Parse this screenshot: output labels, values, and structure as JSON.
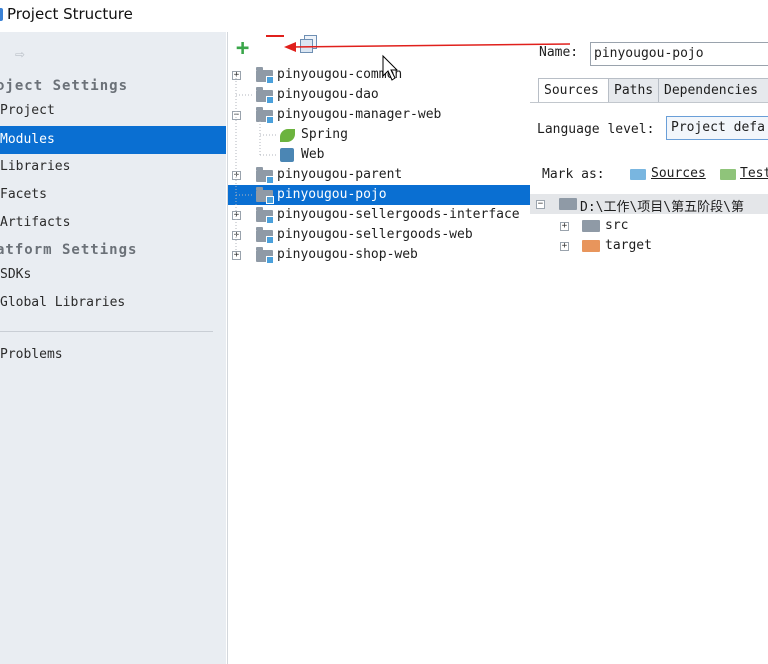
{
  "window": {
    "title": "Project Structure"
  },
  "sidebar": {
    "project_settings_header": "oject Settings",
    "platform_settings_header": "atform Settings",
    "items": [
      {
        "label": "Project"
      },
      {
        "label": "Modules"
      },
      {
        "label": "Libraries"
      },
      {
        "label": "Facets"
      },
      {
        "label": "Artifacts"
      },
      {
        "label": "SDKs"
      },
      {
        "label": "Global Libraries"
      },
      {
        "label": "Problems"
      }
    ],
    "selected": "Modules"
  },
  "toolbar": {
    "add": "+"
  },
  "tree": {
    "rows": [
      {
        "label": "pinyougou-common"
      },
      {
        "label": "pinyougou-dao"
      },
      {
        "label": "pinyougou-manager-web"
      },
      {
        "label": "Spring"
      },
      {
        "label": "Web"
      },
      {
        "label": "pinyougou-parent"
      },
      {
        "label": "pinyougou-pojo"
      },
      {
        "label": "pinyougou-sellergoods-interface"
      },
      {
        "label": "pinyougou-sellergoods-web"
      },
      {
        "label": "pinyougou-shop-web"
      }
    ],
    "selected": "pinyougou-pojo"
  },
  "module": {
    "name_label": "Name:",
    "name_value": "pinyougou-pojo",
    "tabs": [
      {
        "label": "Sources"
      },
      {
        "label": "Paths"
      },
      {
        "label": "Dependencies"
      }
    ],
    "active_tab": "Sources",
    "language_level_label": "Language level:",
    "language_level_value": "Project defa",
    "mark_as_label": "Mark as:",
    "mark_sources": "Sources",
    "mark_tests": "Test",
    "content_root": "D:\\工作\\项目\\第五阶段\\第",
    "folders": [
      {
        "label": "src"
      },
      {
        "label": "target"
      }
    ]
  },
  "colors": {
    "selection": "#0a6fd2",
    "sidebar_bg": "#e9edf2",
    "annotation_red": "#e0201c"
  }
}
